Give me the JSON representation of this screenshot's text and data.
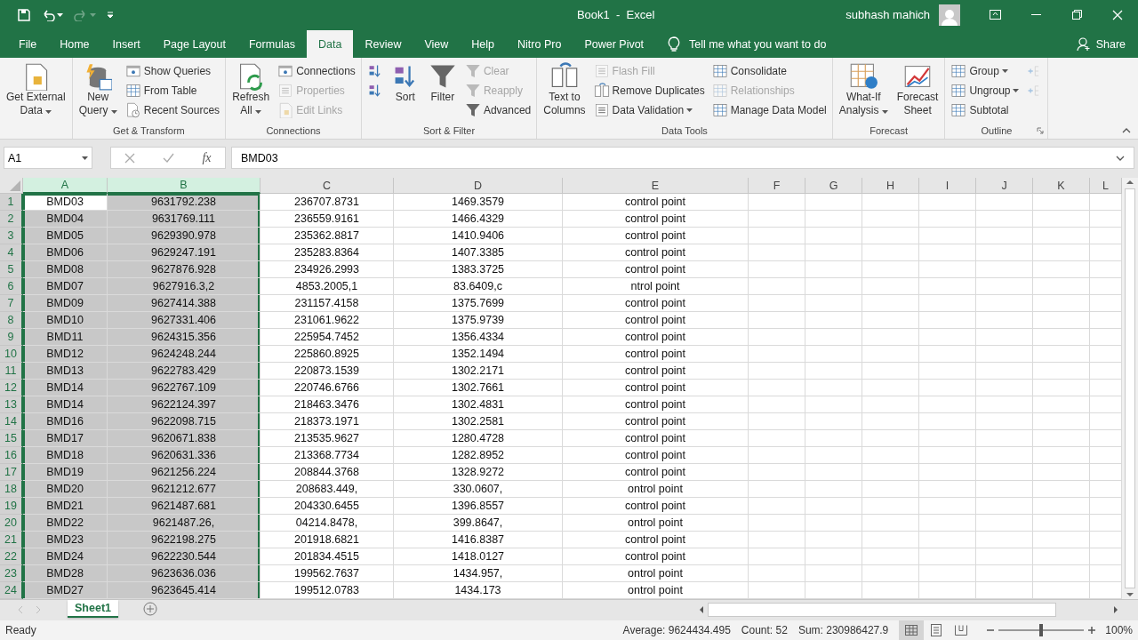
{
  "window": {
    "title": "Book1  -  Excel",
    "user": "subhash mahich"
  },
  "quick_access": {
    "redo_disabled": true
  },
  "tabs": [
    {
      "label": "File",
      "selected": false
    },
    {
      "label": "Home",
      "selected": false
    },
    {
      "label": "Insert",
      "selected": false
    },
    {
      "label": "Page Layout",
      "selected": false
    },
    {
      "label": "Formulas",
      "selected": false
    },
    {
      "label": "Data",
      "selected": true
    },
    {
      "label": "Review",
      "selected": false
    },
    {
      "label": "View",
      "selected": false
    },
    {
      "label": "Help",
      "selected": false
    },
    {
      "label": "Nitro Pro",
      "selected": false
    },
    {
      "label": "Power Pivot",
      "selected": false
    }
  ],
  "tell_me": {
    "placeholder": "Tell me what you want to do"
  },
  "share": "Share",
  "ribbon": [
    {
      "columns": [
        {
          "kind": "large",
          "lines": [
            "Get External",
            "Data"
          ],
          "dropdown": true,
          "disabled": false
        }
      ]
    },
    {
      "label": "Get & Transform",
      "columns": [
        {
          "kind": "large",
          "lines": [
            "New",
            "Query"
          ],
          "dropdown": true,
          "disabled": false
        },
        {
          "kind": "stack",
          "items": [
            {
              "label": "Show Queries",
              "disabled": false,
              "dropdown": false
            },
            {
              "label": "From Table",
              "disabled": false,
              "dropdown": false
            },
            {
              "label": "Recent Sources",
              "disabled": false,
              "dropdown": false
            }
          ]
        }
      ]
    },
    {
      "label": "Connections",
      "columns": [
        {
          "kind": "large",
          "lines": [
            "Refresh",
            "All"
          ],
          "dropdown": true,
          "disabled": false
        },
        {
          "kind": "stack",
          "items": [
            {
              "label": "Connections",
              "disabled": false,
              "dropdown": false
            },
            {
              "label": "Properties",
              "disabled": true,
              "dropdown": false
            },
            {
              "label": "Edit Links",
              "disabled": true,
              "dropdown": false
            }
          ]
        }
      ]
    },
    {
      "label": "Sort & Filter",
      "columns": [
        {
          "kind": "stack",
          "items": [
            {
              "disabled": false,
              "dropdown": false
            },
            {
              "disabled": false,
              "dropdown": false
            }
          ]
        },
        {
          "kind": "large",
          "lines": [
            "Sort"
          ],
          "dropdown": false,
          "disabled": false
        },
        {
          "kind": "large",
          "lines": [
            "Filter"
          ],
          "dropdown": false,
          "disabled": false
        },
        {
          "kind": "stack",
          "items": [
            {
              "label": "Clear",
              "disabled": true,
              "dropdown": false
            },
            {
              "label": "Reapply",
              "disabled": true,
              "dropdown": false
            },
            {
              "label": "Advanced",
              "disabled": false,
              "dropdown": false
            }
          ]
        }
      ]
    },
    {
      "label": "Data Tools",
      "columns": [
        {
          "kind": "large",
          "lines": [
            "Text to",
            "Columns"
          ],
          "dropdown": false,
          "disabled": false
        },
        {
          "kind": "stack",
          "items": [
            {
              "label": "Flash Fill",
              "disabled": true,
              "dropdown": false
            },
            {
              "label": "Remove Duplicates",
              "disabled": false,
              "dropdown": false
            },
            {
              "label": "Data Validation",
              "disabled": false,
              "dropdown": true
            }
          ]
        },
        {
          "kind": "stack",
          "items": [
            {
              "label": "Consolidate",
              "disabled": false,
              "dropdown": false
            },
            {
              "label": "Relationships",
              "disabled": true,
              "dropdown": false
            },
            {
              "label": "Manage Data Model",
              "disabled": false,
              "dropdown": false
            }
          ]
        }
      ]
    },
    {
      "label": "Forecast",
      "columns": [
        {
          "kind": "large",
          "lines": [
            "What-If",
            "Analysis"
          ],
          "dropdown": true,
          "disabled": false
        },
        {
          "kind": "large",
          "lines": [
            "Forecast",
            "Sheet"
          ],
          "dropdown": false,
          "disabled": false
        }
      ]
    },
    {
      "label": "Outline",
      "columns": [
        {
          "kind": "stack",
          "items": [
            {
              "label": "Group",
              "disabled": false,
              "dropdown": true
            },
            {
              "label": "Ungroup",
              "disabled": false,
              "dropdown": true
            },
            {
              "label": "Subtotal",
              "disabled": false,
              "dropdown": false
            }
          ]
        },
        {
          "kind": "stack",
          "items": [
            {
              "disabled": true,
              "dropdown": false
            },
            {
              "disabled": true,
              "dropdown": false
            }
          ]
        }
      ]
    }
  ],
  "formula_bar": {
    "name_box": "A1",
    "function_label": "fx",
    "value": "BMD03"
  },
  "sheet": {
    "columns": [
      {
        "label": "A",
        "selected": true
      },
      {
        "label": "B",
        "selected": true
      },
      {
        "label": "C",
        "selected": false
      },
      {
        "label": "D",
        "selected": false
      },
      {
        "label": "E",
        "selected": false
      },
      {
        "label": "F",
        "selected": false
      },
      {
        "label": "G",
        "selected": false
      },
      {
        "label": "H",
        "selected": false
      },
      {
        "label": "I",
        "selected": false
      },
      {
        "label": "J",
        "selected": false
      },
      {
        "label": "K",
        "selected": false
      },
      {
        "label": "L",
        "selected": false
      }
    ],
    "rows": [
      {
        "number": "1",
        "selected": true,
        "cells": [
          "BMD03",
          "9631792.238",
          "236707.8731",
          "1469.3579",
          "control point"
        ]
      },
      {
        "number": "2",
        "selected": true,
        "cells": [
          "BMD04",
          "9631769.111",
          "236559.9161",
          "1466.4329",
          "control point"
        ]
      },
      {
        "number": "3",
        "selected": true,
        "cells": [
          "BMD05",
          "9629390.978",
          "235362.8817",
          "1410.9406",
          "control point"
        ]
      },
      {
        "number": "4",
        "selected": true,
        "cells": [
          "BMD06",
          "9629247.191",
          "235283.8364",
          "1407.3385",
          "control point"
        ]
      },
      {
        "number": "5",
        "selected": true,
        "cells": [
          "BMD08",
          "9627876.928",
          "234926.2993",
          "1383.3725",
          "control point"
        ]
      },
      {
        "number": "6",
        "selected": true,
        "cells": [
          "BMD07",
          "9627916.3,2",
          "4853.2005,1",
          "83.6409,c",
          "ntrol point"
        ]
      },
      {
        "number": "7",
        "selected": true,
        "cells": [
          "BMD09",
          "9627414.388",
          "231157.4158",
          "1375.7699",
          "control point"
        ]
      },
      {
        "number": "8",
        "selected": true,
        "cells": [
          "BMD10",
          "9627331.406",
          "231061.9622",
          "1375.9739",
          "control point"
        ]
      },
      {
        "number": "9",
        "selected": true,
        "cells": [
          "BMD11",
          "9624315.356",
          "225954.7452",
          "1356.4334",
          "control point"
        ]
      },
      {
        "number": "10",
        "selected": true,
        "cells": [
          "BMD12",
          "9624248.244",
          "225860.8925",
          "1352.1494",
          "control point"
        ]
      },
      {
        "number": "11",
        "selected": true,
        "cells": [
          "BMD13",
          "9622783.429",
          "220873.1539",
          "1302.2171",
          "control point"
        ]
      },
      {
        "number": "12",
        "selected": true,
        "cells": [
          "BMD14",
          "9622767.109",
          "220746.6766",
          "1302.7661",
          "control point"
        ]
      },
      {
        "number": "13",
        "selected": true,
        "cells": [
          "BMD14",
          "9622124.397",
          "218463.3476",
          "1302.4831",
          "control point"
        ]
      },
      {
        "number": "14",
        "selected": true,
        "cells": [
          "BMD16",
          "9622098.715",
          "218373.1971",
          "1302.2581",
          "control point"
        ]
      },
      {
        "number": "15",
        "selected": true,
        "cells": [
          "BMD17",
          "9620671.838",
          "213535.9627",
          "1280.4728",
          "control point"
        ]
      },
      {
        "number": "16",
        "selected": true,
        "cells": [
          "BMD18",
          "9620631.336",
          "213368.7734",
          "1282.8952",
          "control point"
        ]
      },
      {
        "number": "17",
        "selected": true,
        "cells": [
          "BMD19",
          "9621256.224",
          "208844.3768",
          "1328.9272",
          "control point"
        ]
      },
      {
        "number": "18",
        "selected": true,
        "cells": [
          "BMD20",
          "9621212.677",
          "208683.449,",
          "330.0607,",
          "ontrol point"
        ]
      },
      {
        "number": "19",
        "selected": true,
        "cells": [
          "BMD21",
          "9621487.681",
          "204330.6455",
          "1396.8557",
          "control point"
        ]
      },
      {
        "number": "20",
        "selected": true,
        "cells": [
          "BMD22",
          "9621487.26,",
          "04214.8478,",
          "399.8647,",
          "ontrol point"
        ]
      },
      {
        "number": "21",
        "selected": true,
        "cells": [
          "BMD23",
          "9622198.275",
          "201918.6821",
          "1416.8387",
          "control point"
        ]
      },
      {
        "number": "22",
        "selected": true,
        "cells": [
          "BMD24",
          "9622230.544",
          "201834.4515",
          "1418.0127",
          "control point"
        ]
      },
      {
        "number": "23",
        "selected": true,
        "cells": [
          "BMD28",
          "9623636.036",
          "199562.7637",
          "1434.957,",
          "ontrol point"
        ]
      },
      {
        "number": "24",
        "selected": true,
        "cells": [
          "BMD27",
          "9623645.414",
          "199512.0783",
          "1434.173",
          "ontrol point"
        ]
      }
    ]
  },
  "sheet_tabs": [
    {
      "label": "Sheet1",
      "selected": true
    }
  ],
  "status_bar": {
    "mode": "Ready",
    "average": "Average: 9624434.495",
    "count": "Count: 52",
    "sum": "Sum: 230986427.9",
    "views": [
      {
        "selected": true
      },
      {
        "selected": false
      },
      {
        "selected": false
      }
    ],
    "zoom": {
      "level": 0.5,
      "reading": "100%"
    }
  }
}
